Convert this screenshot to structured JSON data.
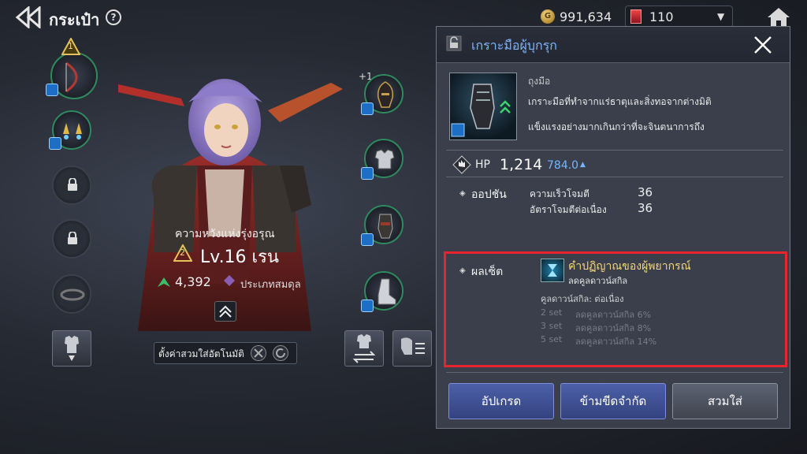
{
  "header": {
    "title": "กระเป๋า",
    "help": "?",
    "gold": "991,634",
    "gems": "110",
    "gold_icon_label": "G"
  },
  "character": {
    "title": "ความหวังแห่งรุ่งอรุณ",
    "tier": "2",
    "level": "Lv.16 เรน",
    "power": "4,392",
    "class": "ประเภทสมดุล"
  },
  "slots": {
    "weapon_badge": "1",
    "helmet_plus": "+1"
  },
  "bottom_left": {
    "auto_equip_label": "ตั้งค่าสวมใส่อัตโนมัติ"
  },
  "panel": {
    "item_name": "เกราะมือผู้บุกรุก",
    "item_type": "ถุงมือ",
    "desc_line1": "เกราะมือที่ทำจากแร่ธาตุและสิ่งทอจากต่างมิติ",
    "desc_line2": "แข็งแรงอย่างมากเกินกว่าที่จะจินตนาการถึง",
    "hp_label": "HP",
    "hp_value": "1,214",
    "hp_sub": "784.0",
    "options_label": "ออปชัน",
    "options": [
      {
        "name": "ความเร็วโจมตี",
        "value": "36"
      },
      {
        "name": "อัตราโจมตีต่อเนื่อง",
        "value": "36"
      }
    ],
    "set_label": "ผลเซ็ต",
    "set_name": "คำปฏิญาณของผู้พยากรณ์",
    "set_sub": "ลดคูลดาวน์สกิล",
    "set_effect": "คูลดาวน์สกิล: ต่อเนื่อง",
    "set_tiers": [
      {
        "tier": "2 set",
        "desc": "ลดคูลดาวน์สกิล 6%"
      },
      {
        "tier": "3 set",
        "desc": "ลดคูลดาวน์สกิล 8%"
      },
      {
        "tier": "5 set",
        "desc": "ลดคูลดาวน์สกิล 14%"
      }
    ],
    "buttons": {
      "upgrade": "อัปเกรด",
      "limit_break": "ข้ามขีดจำกัด",
      "equip": "สวมใส่"
    }
  },
  "colors": {
    "item_name": "#7fb3ff",
    "set_name": "#f5d77a",
    "highlight_box": "#e8252f",
    "equipped_ring": "#2f8a5e"
  }
}
